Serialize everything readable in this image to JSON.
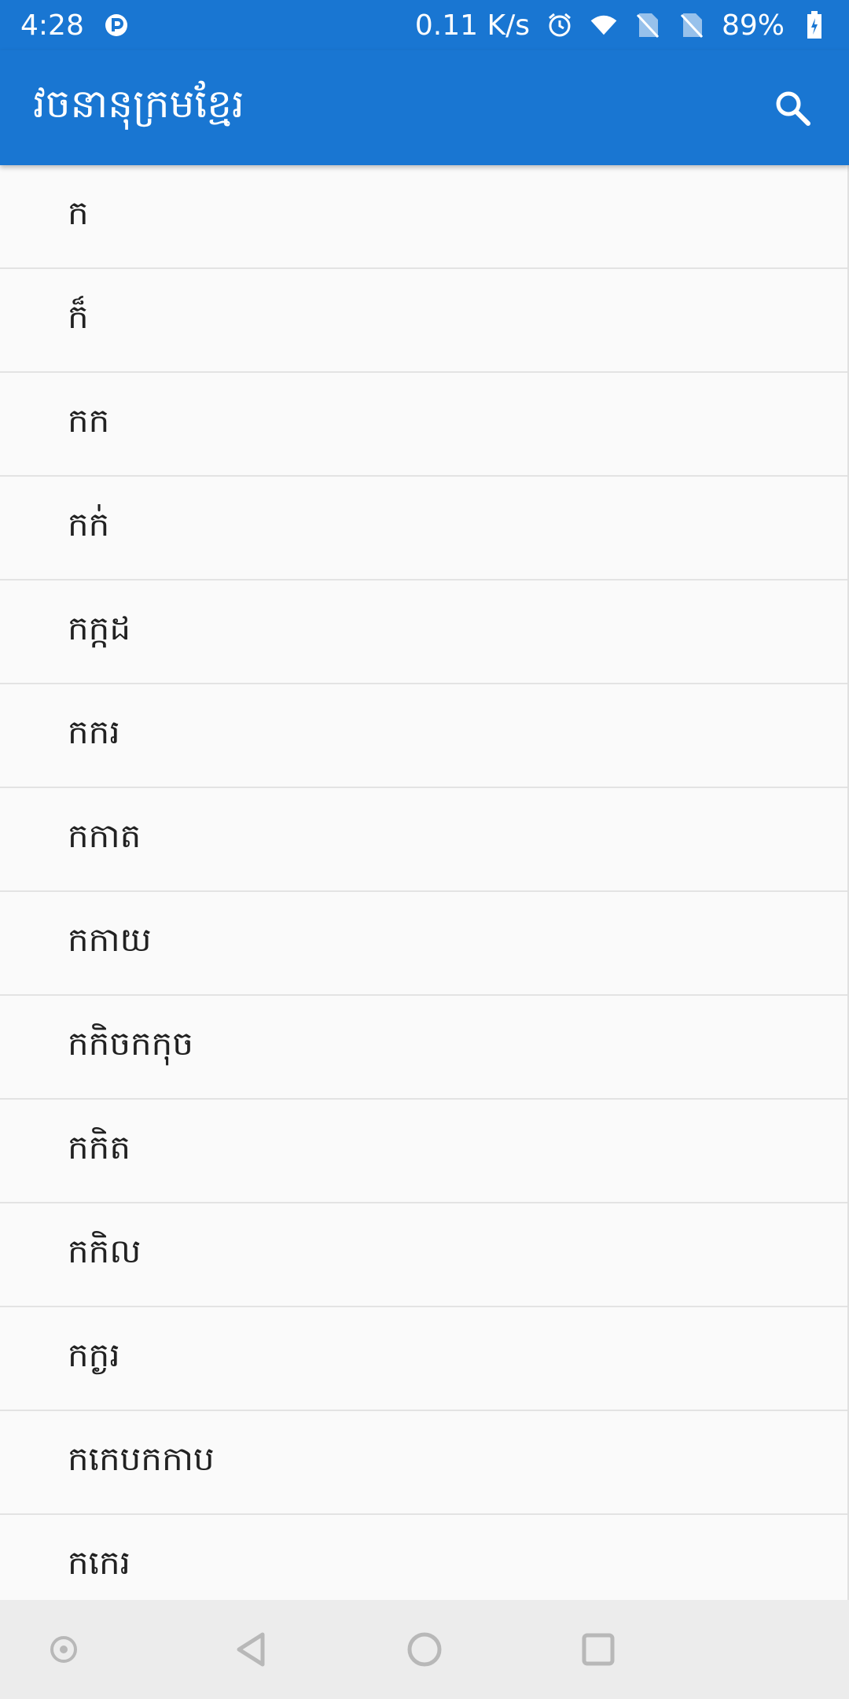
{
  "status_bar": {
    "time": "4:28",
    "notification_icon": "p-icon",
    "network_speed": "0.11 K/s",
    "battery": "89%",
    "icons": [
      "alarm-icon",
      "wifi-icon",
      "no-sim-icon",
      "no-sim-icon",
      "battery-icon"
    ]
  },
  "app_bar": {
    "title": "វចនានុក្រមខ្មែរ",
    "search_icon": "search-icon"
  },
  "list": {
    "items": [
      "ក",
      "ក៏",
      "កក",
      "កក់",
      "កក្កដ",
      "កករ",
      "កកាត",
      "កកាយ",
      "កកិចកកុច",
      "កកិត",
      "កកិល",
      "កក្ងរ",
      "កកេបកកាប",
      "កកេរ"
    ]
  },
  "nav_bar": {
    "buttons": [
      "assist-icon",
      "back-icon",
      "home-icon",
      "recents-icon"
    ]
  },
  "colors": {
    "primary": "#1976d2",
    "background": "#fafafa",
    "divider": "#e3e3e3",
    "nav_background": "#ececec"
  }
}
